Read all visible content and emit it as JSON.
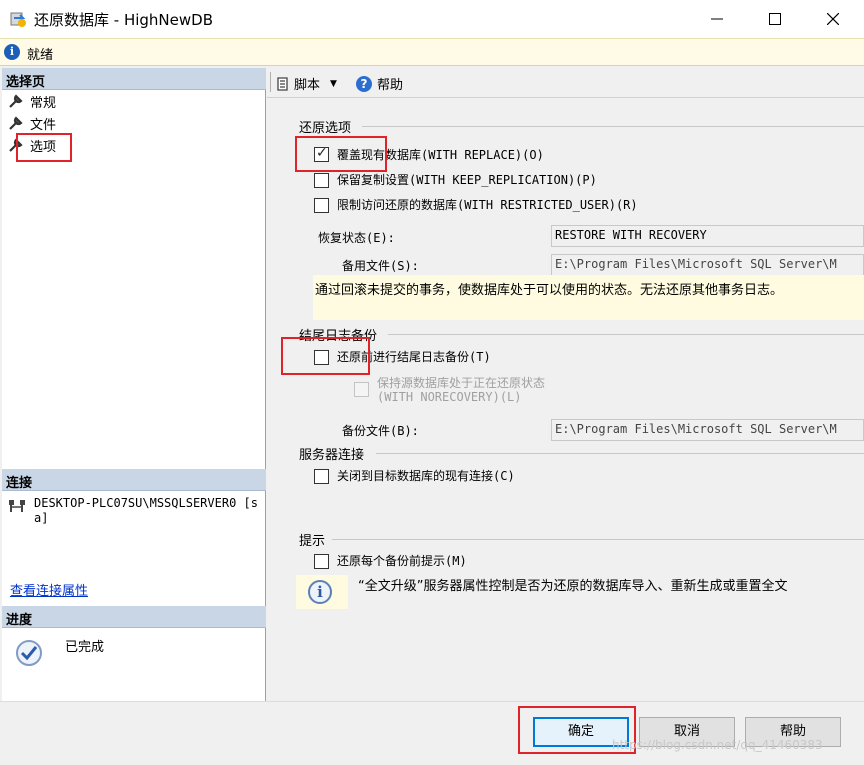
{
  "window": {
    "title": "还原数据库 - HighNewDB",
    "status": "就绪"
  },
  "left": {
    "select_page_header": "选择页",
    "nav_items": [
      {
        "label": "常规",
        "icon": "wrench-icon"
      },
      {
        "label": "文件",
        "icon": "wrench-icon"
      },
      {
        "label": "选项",
        "icon": "wrench-icon"
      }
    ],
    "connection_header": "连接",
    "connection_text": "DESKTOP-PLC07SU\\MSSQLSERVER0 [sa]",
    "view_connection_link": "查看连接属性",
    "progress_header": "进度",
    "progress_status": "已完成"
  },
  "toolbar": {
    "script_label": "脚本",
    "help_label": "帮助"
  },
  "restore_options": {
    "title": "还原选项",
    "overwrite": {
      "label": "覆盖现有数据库(WITH REPLACE)(O)",
      "checked": true
    },
    "keep_replication": {
      "label": "保留复制设置(WITH KEEP_REPLICATION)(P)",
      "checked": false
    },
    "restricted_user": {
      "label": "限制访问还原的数据库(WITH RESTRICTED_USER)(R)",
      "checked": false
    },
    "recovery_state_label": "恢复状态(E):",
    "recovery_state_value": "RESTORE WITH RECOVERY",
    "standby_file_label": "备用文件(S):",
    "standby_file_value": "E:\\Program Files\\Microsoft SQL Server\\M",
    "description": "通过回滚未提交的事务，使数据库处于可以使用的状态。无法还原其他事务日志。"
  },
  "tail_log": {
    "title": "结尾日志备份",
    "backup_before": {
      "label": "还原前进行结尾日志备份(T)",
      "checked": false
    },
    "keep_source": {
      "label_line1": "保持源数据库处于正在还原状态",
      "label_line2": "(WITH NORECOVERY)(L)",
      "checked": false
    },
    "backup_file_label": "备份文件(B):",
    "backup_file_value": "E:\\Program Files\\Microsoft SQL Server\\M"
  },
  "server_connection": {
    "title": "服务器连接",
    "close_connections": {
      "label": "关闭到目标数据库的现有连接(C)",
      "checked": false
    }
  },
  "prompt": {
    "title": "提示",
    "prompt_before": {
      "label": "还原每个备份前提示(M)",
      "checked": false
    },
    "info_text": "“全文升级”服务器属性控制是否为还原的数据库导入、重新生成或重置全文"
  },
  "buttons": {
    "ok": "确定",
    "cancel": "取消",
    "help": "帮助"
  },
  "watermark": "https://blog.csdn.net/qq_41460383",
  "colors": {
    "highlight_red": "#e0222a",
    "section_header": "#c9d6e6",
    "info_yellow": "#fffbe0",
    "primary_blue": "#0078d7"
  }
}
